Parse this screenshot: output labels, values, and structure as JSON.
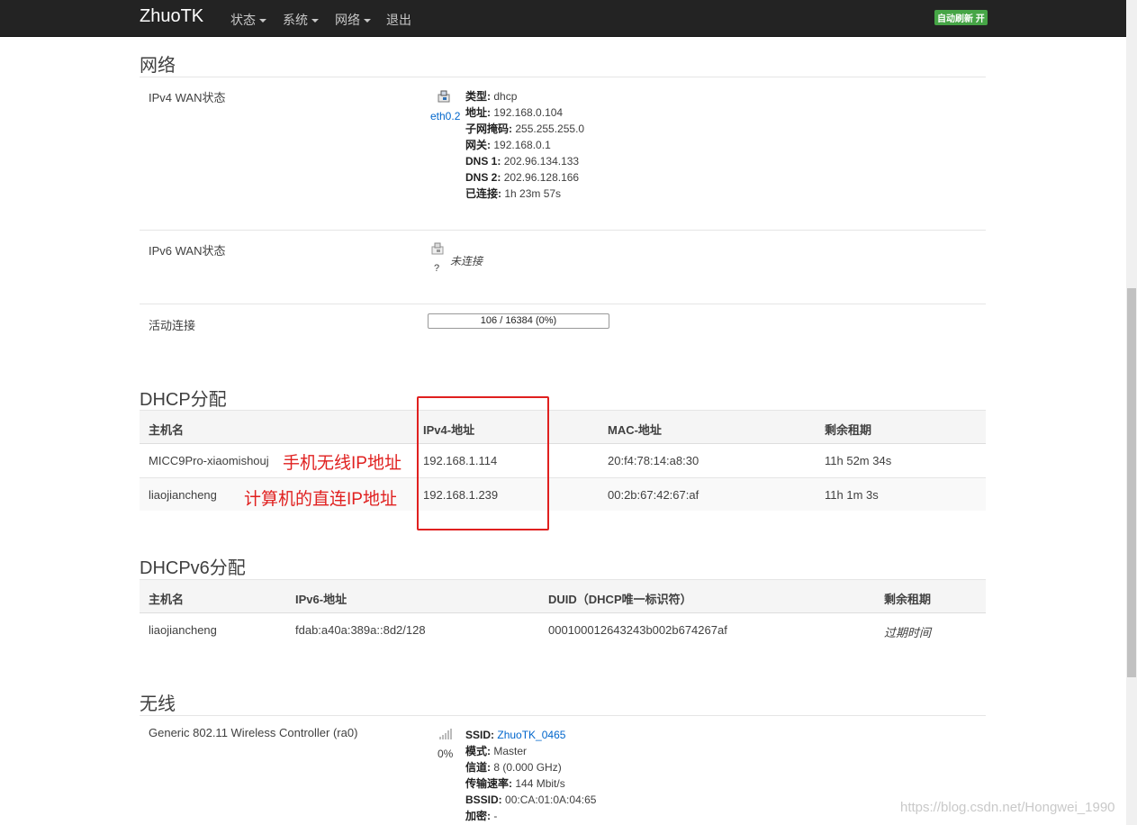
{
  "navbar": {
    "brand": "ZhuoTK",
    "menus": [
      "状态",
      "系统",
      "网络"
    ],
    "logout": "退出",
    "auto_refresh": "自动刷新 开"
  },
  "network": {
    "title": "网络",
    "ipv4": {
      "label": "IPv4 WAN状态",
      "iface": "eth0.2",
      "type_k": "类型:",
      "type_v": "dhcp",
      "addr_k": "地址:",
      "addr_v": "192.168.0.104",
      "mask_k": "子网掩码:",
      "mask_v": "255.255.255.0",
      "gw_k": "网关:",
      "gw_v": "192.168.0.1",
      "dns1_k": "DNS 1:",
      "dns1_v": "202.96.134.133",
      "dns2_k": "DNS 2:",
      "dns2_v": "202.96.128.166",
      "up_k": "已连接:",
      "up_v": "1h 23m 57s"
    },
    "ipv6": {
      "label": "IPv6 WAN状态",
      "iface": "?",
      "status": "未连接"
    },
    "conn": {
      "label": "活动连接",
      "text": "106 / 16384 (0%)",
      "fraction": 0.0065
    }
  },
  "dhcp": {
    "title": "DHCP分配",
    "headers": [
      "主机名",
      "IPv4-地址",
      "MAC-地址",
      "剩余租期"
    ],
    "rows": [
      {
        "host": "MICC9Pro-xiaomishouj",
        "ip": "192.168.1.114",
        "mac": "20:f4:78:14:a8:30",
        "lease": "11h 52m 34s"
      },
      {
        "host": "liaojiancheng",
        "ip": "192.168.1.239",
        "mac": "00:2b:67:42:67:af",
        "lease": "11h 1m 3s"
      }
    ],
    "annotations": [
      "手机无线IP地址",
      "计算机的直连IP地址"
    ]
  },
  "dhcpv6": {
    "title": "DHCPv6分配",
    "headers": [
      "主机名",
      "IPv6-地址",
      "DUID（DHCP唯一标识符）",
      "剩余租期"
    ],
    "rows": [
      {
        "host": "liaojiancheng",
        "ip": "fdab:a40a:389a::8d2/128",
        "duid": "000100012643243b002b674267af",
        "lease": "过期时间"
      }
    ]
  },
  "wireless": {
    "title": "无线",
    "label": "Generic 802.11 Wireless Controller (ra0)",
    "signal": "0%",
    "ssid_k": "SSID:",
    "ssid_v": "ZhuoTK_0465",
    "mode_k": "模式:",
    "mode_v": "Master",
    "chan_k": "信道:",
    "chan_v": "8 (0.000 GHz)",
    "rate_k": "传输速率:",
    "rate_v": "144 Mbit/s",
    "bssid_k": "BSSID:",
    "bssid_v": "00:CA:01:0A:04:65",
    "enc_k": "加密:",
    "enc_v": "-"
  },
  "watermark": "https://blog.csdn.net/Hongwei_1990"
}
